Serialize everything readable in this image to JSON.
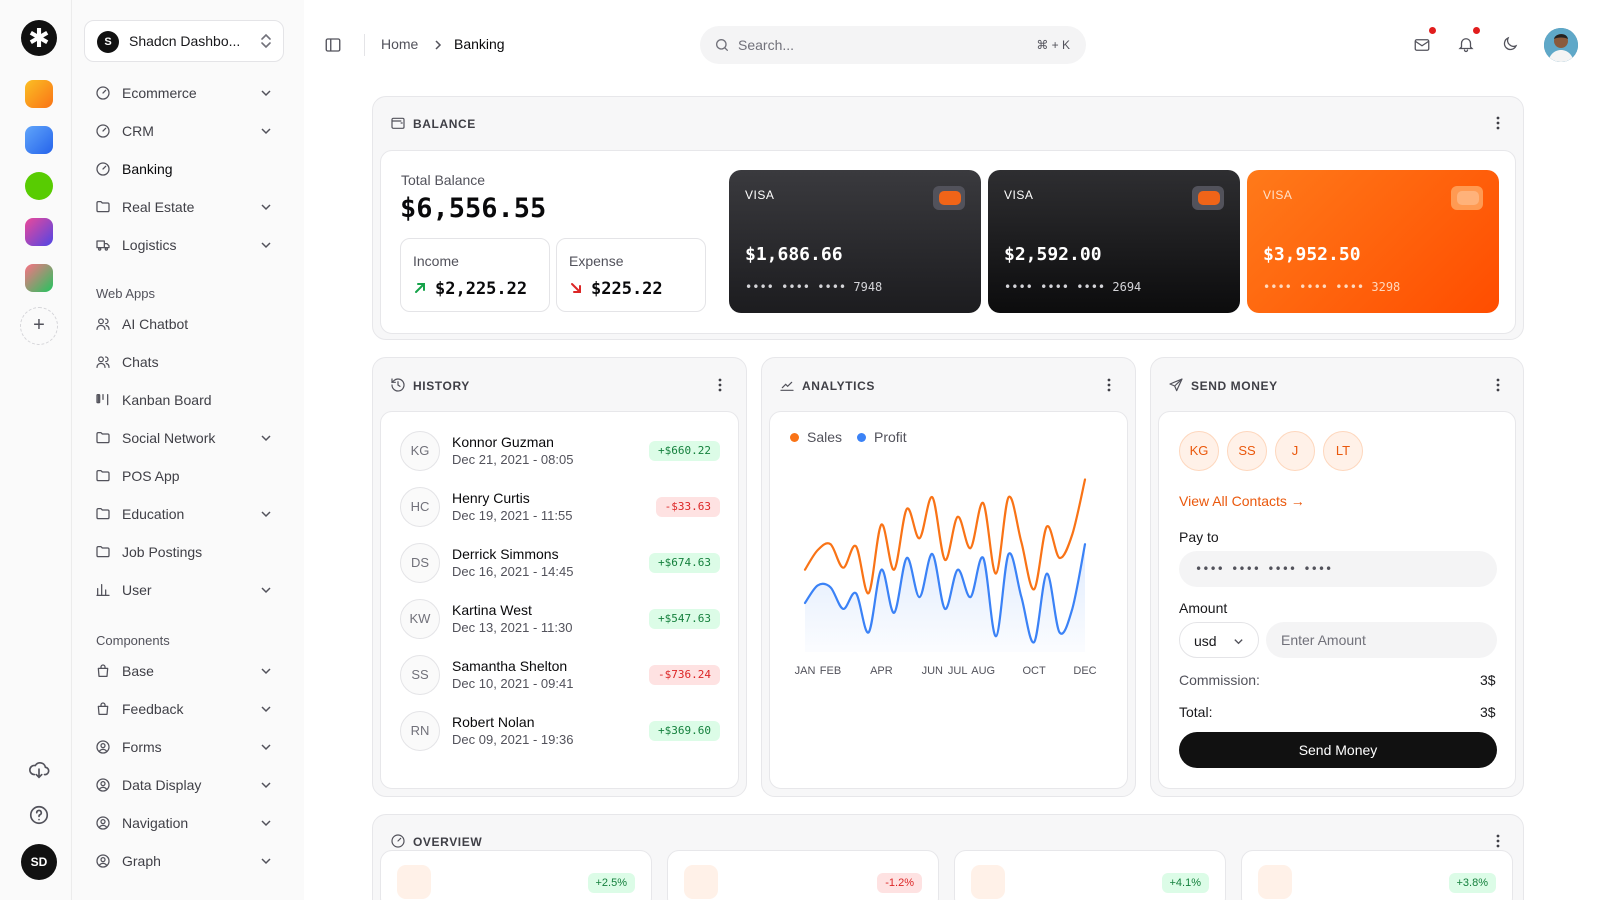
{
  "app": {
    "team_badge": "S",
    "team_name": "Shadcn Dashbo...",
    "user_initials": "SD"
  },
  "sidebar": {
    "items": [
      {
        "label": "Ecommerce",
        "icon": "gauge-icon"
      },
      {
        "label": "CRM",
        "icon": "gauge-icon"
      },
      {
        "label": "Banking",
        "icon": "gauge-icon"
      },
      {
        "label": "Real Estate",
        "icon": "folder-icon"
      },
      {
        "label": "Logistics",
        "icon": "truck-icon"
      },
      {
        "label": "AI Chatbot",
        "icon": "users-icon"
      },
      {
        "label": "Chats",
        "icon": "users-icon"
      },
      {
        "label": "Kanban Board",
        "icon": "kanban-icon"
      },
      {
        "label": "Social Network",
        "icon": "folder-icon"
      },
      {
        "label": "POS App",
        "icon": "folder-icon"
      },
      {
        "label": "Education",
        "icon": "folder-icon"
      },
      {
        "label": "Job Postings",
        "icon": "folder-icon"
      },
      {
        "label": "User",
        "icon": "bar-chart-icon"
      },
      {
        "label": "Base",
        "icon": "shopping-bag-icon"
      },
      {
        "label": "Feedback",
        "icon": "shopping-bag-icon"
      },
      {
        "label": "Forms",
        "icon": "user-circle-icon"
      },
      {
        "label": "Data Display",
        "icon": "user-circle-icon"
      },
      {
        "label": "Navigation",
        "icon": "user-circle-icon"
      },
      {
        "label": "Graph",
        "icon": "user-circle-icon"
      }
    ],
    "groups": {
      "web_apps": "Web Apps",
      "components": "Components"
    }
  },
  "header": {
    "breadcrumb": {
      "home": "Home",
      "current": "Banking"
    },
    "search": {
      "placeholder": "Search...",
      "shortcut": "⌘ + K"
    }
  },
  "balance": {
    "title": "BALANCE",
    "total_label": "Total Balance",
    "total_value": "$6,556.55",
    "income": {
      "label": "Income",
      "value": "$2,225.22"
    },
    "expense": {
      "label": "Expense",
      "value": "$225.22"
    },
    "cards": [
      {
        "brand": "VISA",
        "amount": "$1,686.66",
        "number": "•••• •••• •••• 7948"
      },
      {
        "brand": "VISA",
        "amount": "$2,592.00",
        "number": "•••• •••• •••• 2694"
      },
      {
        "brand": "VISA",
        "amount": "$3,952.50",
        "number": "•••• •••• •••• 3298"
      }
    ]
  },
  "history": {
    "title": "HISTORY",
    "rows": [
      {
        "initials": "KG",
        "name": "Konnor Guzman",
        "date": "Dec 21, 2021 - 08:05",
        "amount": "+$660.22",
        "type": "pos"
      },
      {
        "initials": "HC",
        "name": "Henry Curtis",
        "date": "Dec 19, 2021 - 11:55",
        "amount": "-$33.63",
        "type": "neg"
      },
      {
        "initials": "DS",
        "name": "Derrick Simmons",
        "date": "Dec 16, 2021 - 14:45",
        "amount": "+$674.63",
        "type": "pos"
      },
      {
        "initials": "KW",
        "name": "Kartina West",
        "date": "Dec 13, 2021 - 11:30",
        "amount": "+$547.63",
        "type": "pos"
      },
      {
        "initials": "SS",
        "name": "Samantha Shelton",
        "date": "Dec 10, 2021 - 09:41",
        "amount": "-$736.24",
        "type": "neg"
      },
      {
        "initials": "RN",
        "name": "Robert Nolan",
        "date": "Dec 09, 2021 - 19:36",
        "amount": "+$369.60",
        "type": "pos"
      }
    ]
  },
  "analytics": {
    "title": "ANALYTICS",
    "colors": {
      "sales": "#f97316",
      "profit": "#3b82f6"
    }
  },
  "chart_data": {
    "type": "line",
    "x_ticks": [
      "JAN",
      "FEB",
      "APR",
      "JUN",
      "JUL",
      "AUG",
      "OCT",
      "DEC"
    ],
    "x": [
      1,
      1.5,
      2,
      2.5,
      3,
      3.5,
      4,
      4.5,
      5,
      5.5,
      6,
      6.5,
      7,
      7.5,
      8,
      8.5,
      9,
      9.5,
      10,
      10.5,
      11,
      11.5,
      12
    ],
    "series": [
      {
        "name": "Sales",
        "values": [
          42,
          52,
          55,
          43,
          54,
          30,
          65,
          42,
          73,
          58,
          79,
          47,
          69,
          53,
          76,
          40,
          79,
          56,
          32,
          64,
          48,
          60,
          88
        ]
      },
      {
        "name": "Profit",
        "values": [
          25,
          34,
          33,
          22,
          30,
          10,
          42,
          20,
          48,
          28,
          50,
          22,
          42,
          28,
          48,
          8,
          50,
          28,
          5,
          40,
          10,
          22,
          55
        ]
      }
    ],
    "ylim": [
      0,
      100
    ],
    "grid": false,
    "legend": "top-left"
  },
  "send_money": {
    "title": "SEND MONEY",
    "contacts": [
      "KG",
      "SS",
      "J",
      "LT"
    ],
    "view_all": "View All Contacts →",
    "pay_to_label": "Pay to",
    "pay_to_value": "•••• •••• •••• ••••",
    "amount_label": "Amount",
    "currency": "usd",
    "amount_placeholder": "Enter Amount",
    "commission_label": "Commission:",
    "commission_value": "3$",
    "total_label": "Total:",
    "total_value": "3$",
    "button": "Send Money"
  },
  "overview": {
    "title": "OVERVIEW",
    "badges": [
      "+2.5%",
      "-1.2%",
      "+4.1%",
      "+3.8%"
    ]
  }
}
